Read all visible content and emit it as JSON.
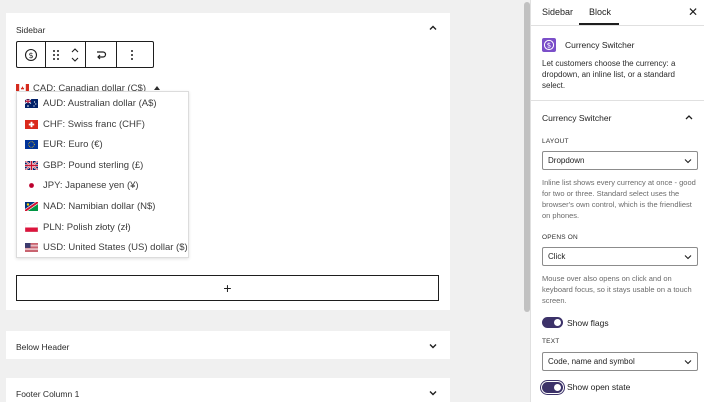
{
  "editor": {
    "sidebar_panel": {
      "title": "Sidebar",
      "switcher": {
        "current": "CAD: Canadian dollar (C$)",
        "options": [
          {
            "label": "AUD: Australian dollar (A$)",
            "flag": "au"
          },
          {
            "label": "CHF: Swiss franc (CHF)",
            "flag": "ch"
          },
          {
            "label": "EUR: Euro (€)",
            "flag": "eu"
          },
          {
            "label": "GBP: Pound sterling (£)",
            "flag": "gb"
          },
          {
            "label": "JPY: Japanese yen (¥)",
            "flag": "jp"
          },
          {
            "label": "NAD: Namibian dollar (N$)",
            "flag": "na"
          },
          {
            "label": "PLN: Polish złoty (zł)",
            "flag": "pl"
          },
          {
            "label": "USD: United States (US) dollar ($)",
            "flag": "us"
          }
        ]
      },
      "inserter_label": "+"
    },
    "below_header_panel": {
      "title": "Below Header"
    },
    "footer_panel": {
      "title": "Footer Column 1"
    }
  },
  "settings": {
    "tabs": [
      {
        "label": "Sidebar"
      },
      {
        "label": "Block"
      }
    ],
    "active_tab": "Block",
    "close_label": "✕",
    "block": {
      "name": "Currency Switcher",
      "description": "Let customers choose the currency: a dropdown, an inline list, or a standard select."
    },
    "section_title": "Currency Switcher",
    "layout": {
      "label": "LAYOUT",
      "value": "Dropdown",
      "help": "Inline list shows every currency at once - good for two or three. Standard select uses the browser's own control, which is the friendliest on phones."
    },
    "opens_on": {
      "label": "OPENS ON",
      "value": "Click",
      "help": "Mouse over also opens on click and on keyboard focus, so it stays usable on a touch screen."
    },
    "show_flags": {
      "label": "Show flags",
      "on": true
    },
    "text": {
      "label": "TEXT",
      "value": "Code, name and symbol"
    },
    "show_open_state": {
      "label": "Show open state",
      "on": true
    }
  },
  "colors": {
    "accent": "#3c3269",
    "block_icon": "#7b4fc9"
  }
}
